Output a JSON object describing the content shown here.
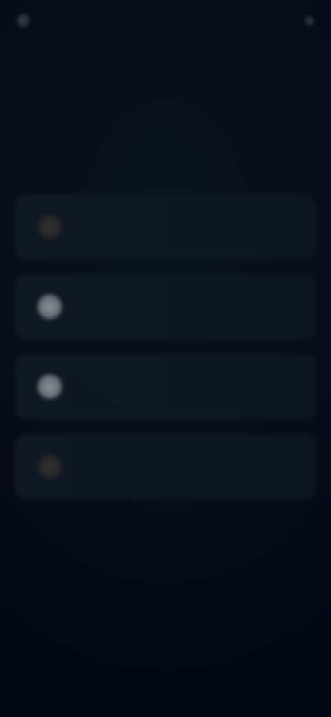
{
  "topbar": {
    "brand": "",
    "right": ""
  },
  "eyebrow": "",
  "title": "",
  "options": [
    {
      "label": ""
    },
    {
      "label": ""
    },
    {
      "label": ""
    },
    {
      "label": ""
    }
  ],
  "colors": {
    "background": "#060b16",
    "card": "#111a27",
    "text": "#cfd6e2"
  },
  "icons": {
    "brand": "logo-icon",
    "option_1": "circle-icon",
    "option_2": "circle-icon",
    "option_3": "circle-icon",
    "option_4": "circle-icon"
  }
}
